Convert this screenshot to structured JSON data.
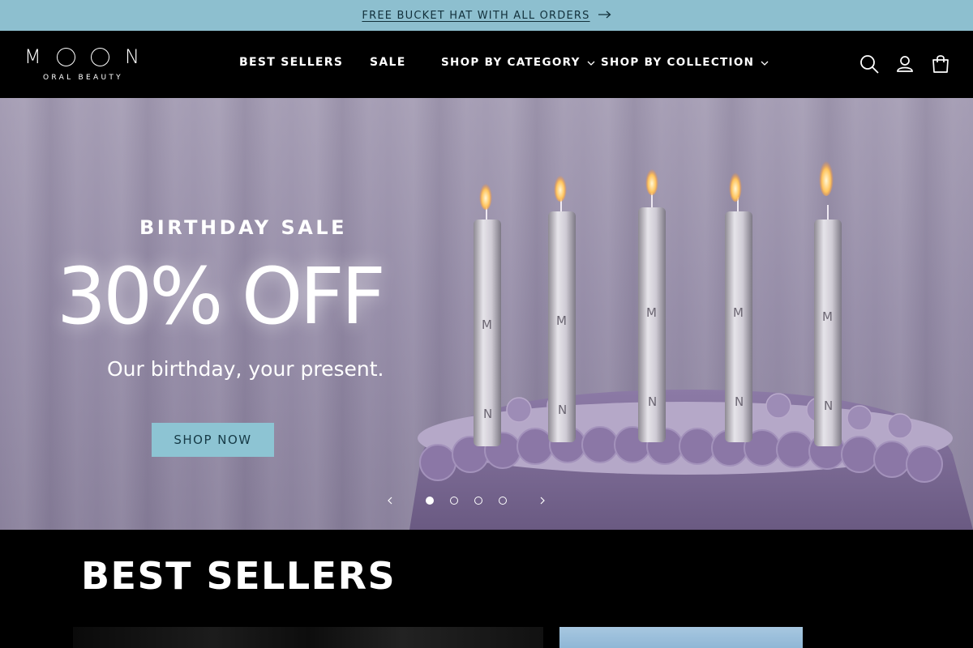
{
  "announcement": {
    "text": "FREE BUCKET HAT WITH ALL ORDERS",
    "icon": "arrow-right-icon"
  },
  "header": {
    "logo": {
      "word": "MOON",
      "tagline": "ORAL BEAUTY"
    },
    "nav": [
      {
        "label": "BEST SELLERS",
        "has_dropdown": false
      },
      {
        "label": "SALE",
        "has_dropdown": false
      },
      {
        "label": "SHOP BY CATEGORY",
        "has_dropdown": true
      },
      {
        "label": "SHOP BY COLLECTION",
        "has_dropdown": true
      }
    ],
    "icons": [
      "search-icon",
      "account-icon",
      "cart-icon"
    ]
  },
  "hero": {
    "kicker": "BIRTHDAY SALE",
    "title": "30% OFF",
    "subtitle": "Our birthday, your present.",
    "cta": "SHOP NOW",
    "slides_total": 4,
    "active_slide": 1
  },
  "best_sellers": {
    "title": "BEST SELLERS"
  },
  "colors": {
    "announce_bg": "#8dbfcf",
    "header_bg": "#000000",
    "cta_bg": "#8dc4d3",
    "hero_bg": "#9a91ab"
  }
}
